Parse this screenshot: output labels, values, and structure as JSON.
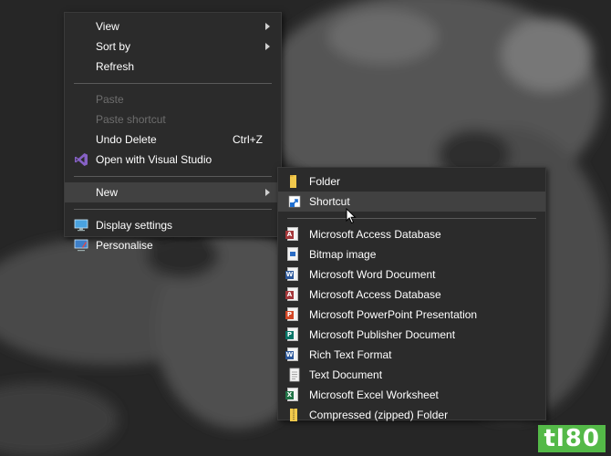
{
  "main_menu": {
    "items": [
      {
        "label": "View"
      },
      {
        "label": "Sort by"
      },
      {
        "label": "Refresh"
      },
      {
        "label": "Paste"
      },
      {
        "label": "Paste shortcut"
      },
      {
        "label": "Undo Delete",
        "shortcut": "Ctrl+Z"
      },
      {
        "label": "Open with Visual Studio",
        "icon": "visual-studio-icon"
      },
      {
        "label": "New"
      },
      {
        "label": "Display settings",
        "icon": "display-settings-icon"
      },
      {
        "label": "Personalise",
        "icon": "personalise-icon"
      }
    ]
  },
  "new_submenu": {
    "items": [
      {
        "label": "Folder",
        "icon": "folder-icon"
      },
      {
        "label": "Shortcut",
        "icon": "shortcut-icon"
      },
      {
        "label": "Microsoft Access Database",
        "icon": "access-icon"
      },
      {
        "label": "Bitmap image",
        "icon": "bitmap-icon"
      },
      {
        "label": "Microsoft Word Document",
        "icon": "word-icon"
      },
      {
        "label": "Microsoft Access Database",
        "icon": "access-icon"
      },
      {
        "label": "Microsoft PowerPoint Presentation",
        "icon": "powerpoint-icon"
      },
      {
        "label": "Microsoft Publisher Document",
        "icon": "publisher-icon"
      },
      {
        "label": "Rich Text Format",
        "icon": "word-icon"
      },
      {
        "label": "Text Document",
        "icon": "text-document-icon"
      },
      {
        "label": "Microsoft Excel Worksheet",
        "icon": "excel-icon"
      },
      {
        "label": "Compressed (zipped) Folder",
        "icon": "zip-folder-icon"
      }
    ]
  },
  "watermark": {
    "text": "tl80"
  },
  "colors": {
    "menu_bg": "#2b2b2b",
    "highlight": "#414141",
    "disabled_text": "#6d6d6d",
    "watermark_bg": "#54b948"
  }
}
